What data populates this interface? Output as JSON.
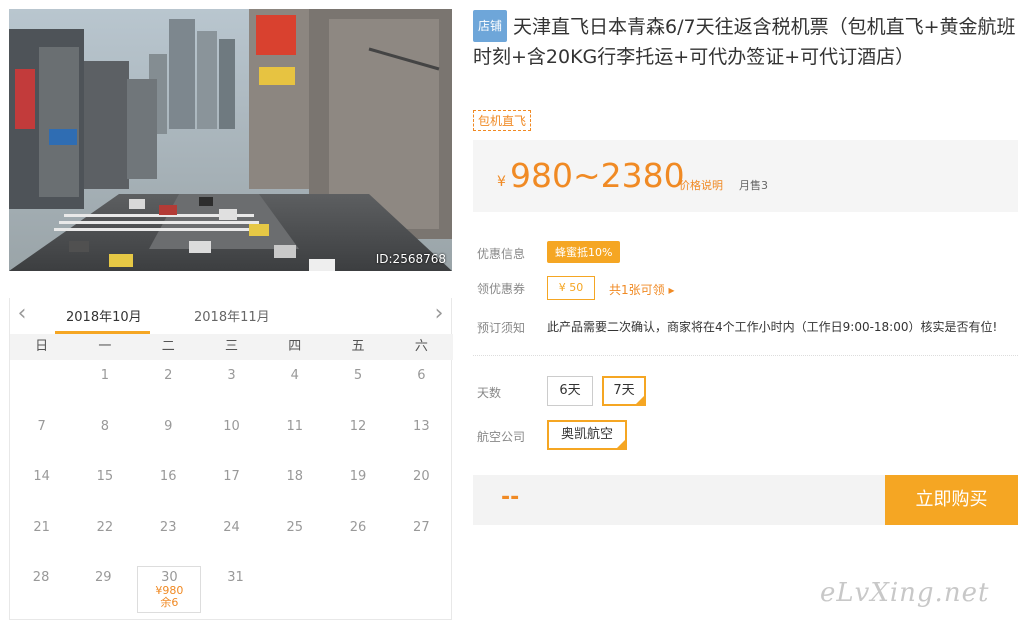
{
  "photo": {
    "id_label": "ID:2568768"
  },
  "calendar": {
    "tabs": [
      "2018年10月",
      "2018年11月"
    ],
    "weekdays": [
      "日",
      "一",
      "二",
      "三",
      "四",
      "五",
      "六"
    ],
    "rows": [
      [
        "",
        "1",
        "2",
        "3",
        "4",
        "5",
        "6"
      ],
      [
        "7",
        "8",
        "9",
        "10",
        "11",
        "12",
        "13"
      ],
      [
        "14",
        "15",
        "16",
        "17",
        "18",
        "19",
        "20"
      ],
      [
        "21",
        "22",
        "23",
        "24",
        "25",
        "26",
        "27"
      ],
      [
        "28",
        "29",
        "30",
        "31",
        "",
        "",
        ""
      ]
    ],
    "selected": {
      "day": "30",
      "price": "¥980",
      "stock": "余6"
    }
  },
  "product": {
    "shop_badge": "店铺",
    "title": "天津直飞日本青森6/7天往返含税机票（包机直飞+黄金航班时刻+含20KG行李托运+可代办签证+可代订酒店）",
    "tag": "包机直飞",
    "yen": "¥",
    "price_range": "980~2380",
    "price_note": "价格说明",
    "sold": "月售3"
  },
  "info": {
    "promo_label": "优惠信息",
    "promo_badge": "蜂蜜抵10%",
    "coupon_label": "领优惠券",
    "coupon_value": "¥ 50",
    "coupon_link": "共1张可领 ▸",
    "notice_label": "预订须知",
    "notice_text": "此产品需要二次确认，商家将在4个工作小时内（工作日9:00-18:00）核实是否有位!"
  },
  "options": {
    "days_label": "天数",
    "days": [
      "6天",
      "7天"
    ],
    "airline_label": "航空公司",
    "airline": "奥凯航空"
  },
  "buy": {
    "placeholder": "--",
    "button": "立即购买"
  },
  "watermark": "eLvXing.net",
  "colors": {
    "accent": "#f5a623",
    "price": "#f08a24",
    "shop_badge": "#6ea6d9"
  }
}
